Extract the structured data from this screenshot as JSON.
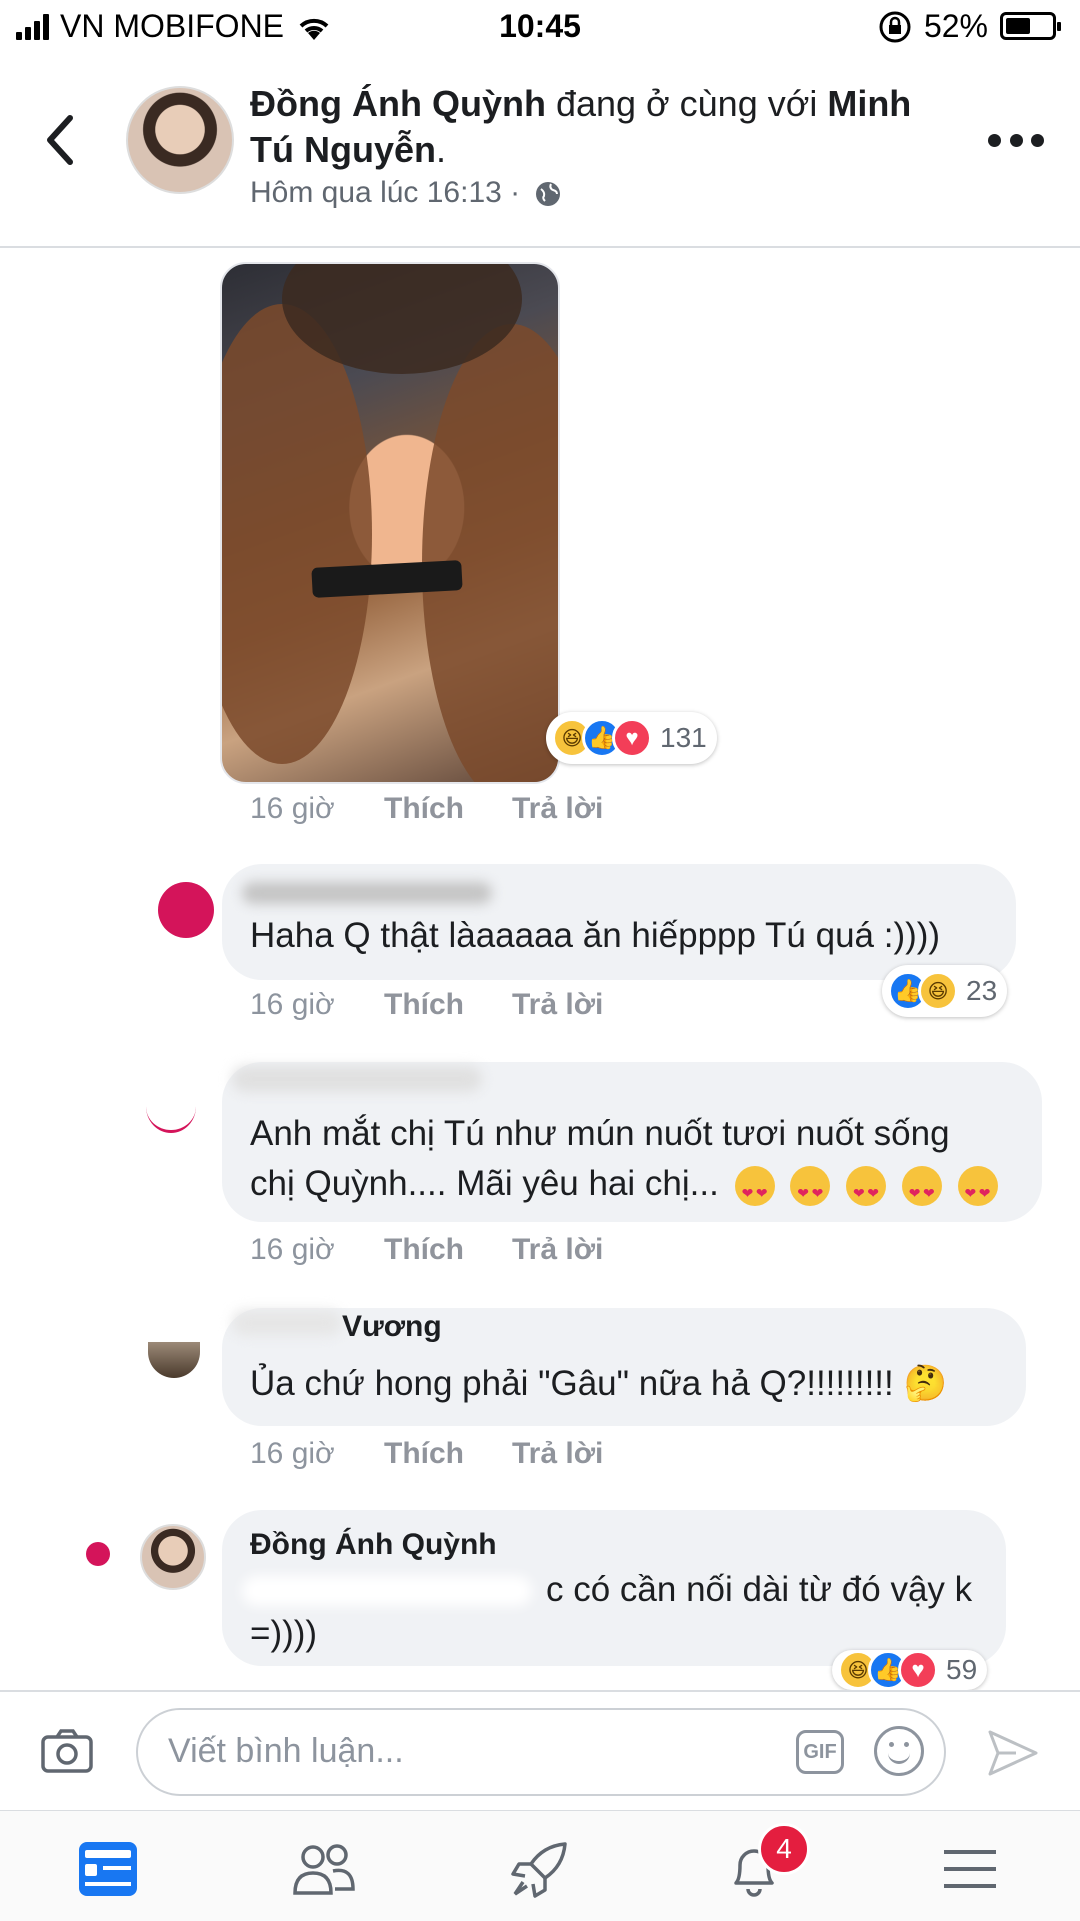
{
  "status_bar": {
    "carrier": "VN MOBIFONE",
    "time": "10:45",
    "battery": "52%"
  },
  "post_header": {
    "author": "Đồng Ánh Quỳnh",
    "with_text": " đang ở cùng với ",
    "tagged_line1": "Minh",
    "tagged_line2": "Tú Nguyễn",
    "tagged_suffix": ".",
    "timestamp": "Hôm qua lúc 16:13 ·",
    "privacy_icon": "globe-icon"
  },
  "photo_comment": {
    "reactions": {
      "icons": [
        "haha",
        "like",
        "love"
      ],
      "count": "131"
    },
    "time": "16 giờ",
    "like_label": "Thích",
    "reply_label": "Trả lời"
  },
  "comments": [
    {
      "text": "Haha Q thật làaaaaa ăn hiếpppp Tú quá :))))",
      "reactions": {
        "icons": [
          "like",
          "haha"
        ],
        "count": "23"
      },
      "time": "16 giờ",
      "like_label": "Thích",
      "reply_label": "Trả lời"
    },
    {
      "text_line1": "Anh mắt chị Tú như mún nuốt tươi nuốt sống",
      "text_line2": "chị Quỳnh.... Mãi yêu hai chị...",
      "time": "16 giờ",
      "like_label": "Thích",
      "reply_label": "Trả lời"
    },
    {
      "name_partial": "Vương",
      "text": "Ủa chứ hong phải \"Gâu\" nữa hả Q?!!!!!!!!! 🤔",
      "time": "16 giờ",
      "like_label": "Thích",
      "reply_label": "Trả lời"
    },
    {
      "name": "Đồng Ánh Quỳnh",
      "text_line1": "c có cần nối dài từ đó vậy k",
      "text_line2": "=))))",
      "reactions": {
        "icons": [
          "haha",
          "like",
          "love"
        ],
        "count": "59"
      }
    }
  ],
  "composer": {
    "placeholder": "Viết bình luận...",
    "gif_label": "GIF"
  },
  "tab_bar": {
    "notifications_badge": "4"
  },
  "colors": {
    "facebook_blue": "#1877f2",
    "love_red": "#f33e58",
    "haha_yellow": "#f7c33c",
    "badge_red": "#e41e3f"
  }
}
